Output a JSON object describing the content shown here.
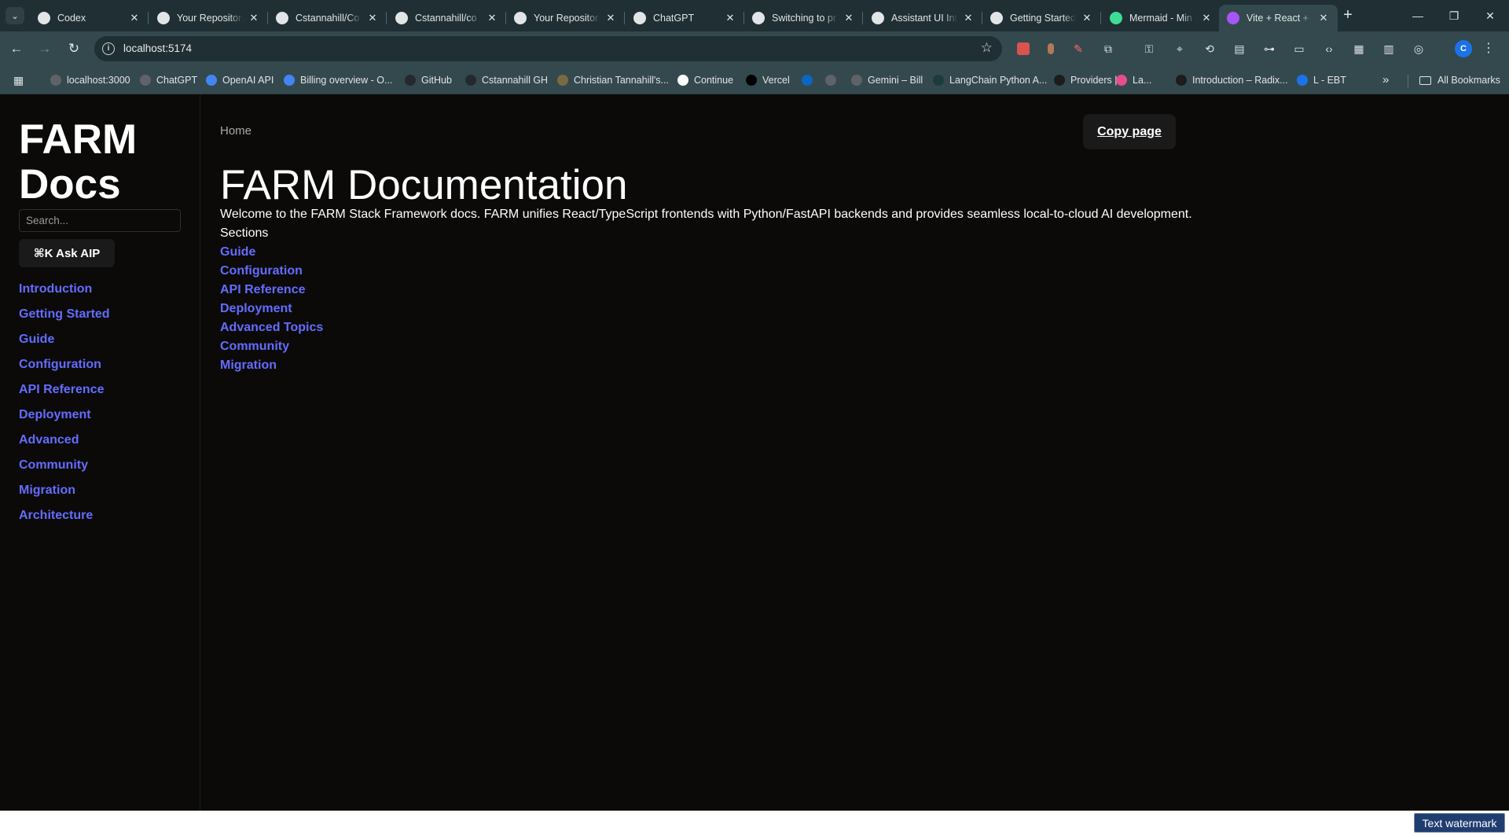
{
  "browser": {
    "tabs": [
      {
        "title": "Codex",
        "icon": "openai-icon",
        "color": "#e1e5e6"
      },
      {
        "title": "Your Repositories",
        "icon": "github-icon",
        "color": "#e1e5e6"
      },
      {
        "title": "Cstannahill/Co",
        "icon": "github-icon",
        "color": "#e1e5e6"
      },
      {
        "title": "Cstannahill/co",
        "icon": "github-icon",
        "color": "#e1e5e6"
      },
      {
        "title": "Your Repositories",
        "icon": "github-icon",
        "color": "#e1e5e6"
      },
      {
        "title": "ChatGPT",
        "icon": "openai-icon",
        "color": "#e1e5e6"
      },
      {
        "title": "Switching to pr",
        "icon": "openai-icon",
        "color": "#e1e5e6"
      },
      {
        "title": "Assistant UI Int",
        "icon": "openai-icon",
        "color": "#e1e5e6"
      },
      {
        "title": "Getting Started",
        "icon": "docs-icon",
        "color": "#e1e5e6"
      },
      {
        "title": "Mermaid - Min",
        "icon": "mermaid-icon",
        "color": "#3ddc97"
      },
      {
        "title": "Vite + React +",
        "icon": "vite-icon",
        "color": "#a855f7"
      }
    ],
    "active_tab": 10,
    "url": "localhost:5174",
    "profile_initial": "C",
    "bookmarks": [
      {
        "label": "localhost:3000",
        "icon": "globe-icon",
        "color": "#5f6368"
      },
      {
        "label": "ChatGPT",
        "icon": "openai-icon",
        "color": "#5f6368"
      },
      {
        "label": "OpenAI API",
        "icon": "openai-icon",
        "color": "#4285f4"
      },
      {
        "label": "Billing overview - O...",
        "icon": "openai-icon",
        "color": "#4285f4"
      },
      {
        "label": "GitHub",
        "icon": "github-icon",
        "color": "#24292e"
      },
      {
        "label": "Cstannahill GH",
        "icon": "github-icon",
        "color": "#24292e"
      },
      {
        "label": "Christian Tannahill's...",
        "icon": "bookmark-icon",
        "color": "#7a6a40"
      },
      {
        "label": "Continue",
        "icon": "continue-icon",
        "color": "#ffffff"
      },
      {
        "label": "Vercel",
        "icon": "vercel-icon",
        "color": "#000000"
      },
      {
        "label": "",
        "icon": "linkedin-icon",
        "color": "#0a66c2"
      },
      {
        "label": "",
        "icon": "globe-icon",
        "color": "#5f6368"
      },
      {
        "label": "Gemini – Bill",
        "icon": "gear-icon",
        "color": "#5f6368"
      },
      {
        "label": "LangChain Python A...",
        "icon": "langchain-icon",
        "color": "#1c3c3c"
      },
      {
        "label": "Providers |",
        "icon": "providers-icon",
        "color": "#1c1c1c"
      },
      {
        "label": "La...",
        "icon": "link-icon",
        "color": "#e84c8b"
      },
      {
        "label": "Introduction – Radix...",
        "icon": "radix-icon",
        "color": "#1c1c1c"
      },
      {
        "label": "L - EBT",
        "icon": "ebt-icon",
        "color": "#1a73e8"
      }
    ],
    "all_bookmarks": "All Bookmarks"
  },
  "sidebar": {
    "logo": "FARM Docs",
    "search_placeholder": "Search...",
    "ask_button": "⌘K Ask AIP",
    "nav": [
      "Introduction",
      "Getting Started",
      "Guide",
      "Configuration",
      "API Reference",
      "Deployment",
      "Advanced",
      "Community",
      "Migration",
      "Architecture"
    ]
  },
  "main": {
    "breadcrumb": "Home",
    "copy_button": "Copy page",
    "title": "FARM Documentation",
    "intro": "Welcome to the FARM Stack Framework docs. FARM unifies React/TypeScript frontends with Python/FastAPI backends and provides seamless local-to-cloud AI development.",
    "sections_label": "Sections",
    "sections": [
      "Guide",
      "Configuration",
      "API Reference",
      "Deployment",
      "Advanced Topics",
      "Community",
      "Migration"
    ]
  },
  "watermark": "Text watermark",
  "colors": {
    "link": "#646cff",
    "page_bg": "#0b0a09",
    "chrome_dark": "#1f2f33",
    "chrome_light": "#34494e"
  }
}
